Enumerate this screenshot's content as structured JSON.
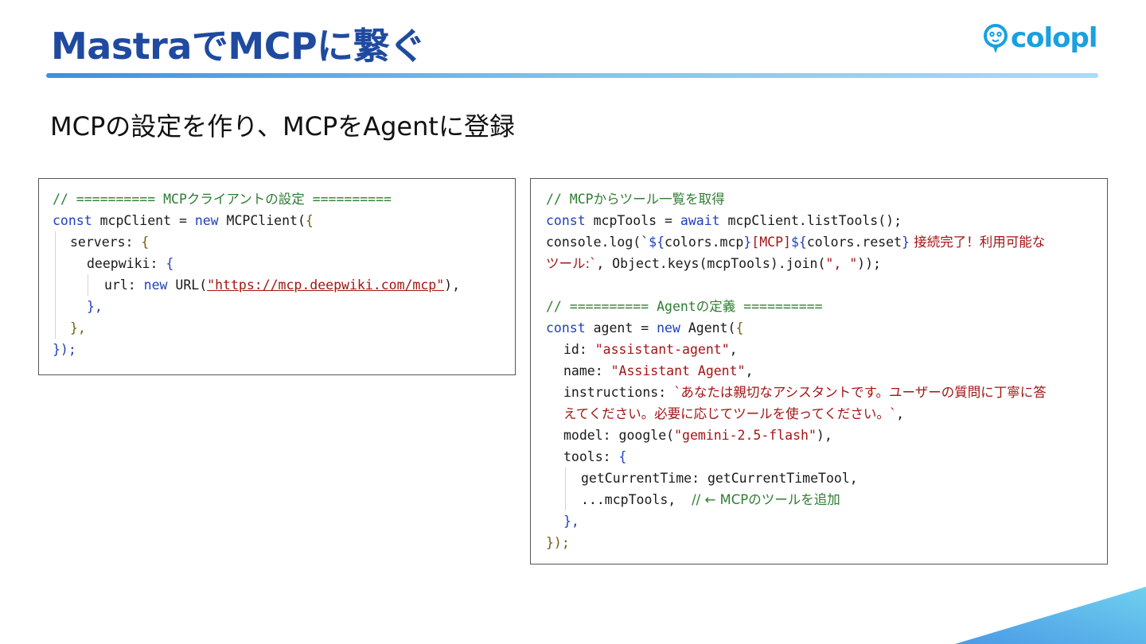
{
  "slide": {
    "title": "MastraでMCPに繋ぐ",
    "logo_text": "colopl",
    "logo_icon": "colopl-mascot-icon",
    "subtitle": "MCPの設定を作り、MCPをAgentに登録",
    "accent_color": "#1f4aa0",
    "logo_color": "#1aa0e0"
  },
  "code_left": {
    "l1": "// ========== MCPクライアントの設定 ==========",
    "l2_kw": "const",
    "l2_a": " mcpClient = ",
    "l2_new": "new",
    "l2_b": " MCPClient(",
    "l2_br": "{",
    "l3": "servers: ",
    "l3_br": "{",
    "l4": "deepwiki: ",
    "l4_br": "{",
    "l5_a": "url: ",
    "l5_new": "new",
    "l5_b": " URL(",
    "l5_url": "\"https://mcp.deepwiki.com/mcp\"",
    "l5_c": "),",
    "l6": "},",
    "l7": "},",
    "l8": "});"
  },
  "code_right": {
    "r1": "// MCPからツール一覧を取得",
    "r2_kw": "const",
    "r2_a": " mcpTools = ",
    "r2_await": "await",
    "r2_b": " mcpClient.listTools();",
    "r3_a": "console.log(`",
    "r3_t1": "${",
    "r3_b": "colors.mcp",
    "r3_t2": "}",
    "r3_c": "[MCP]",
    "r3_t3": "${",
    "r3_d": "colors.reset",
    "r3_t4": "}",
    "r3_e": " 接続完了！利用可能な",
    "r4_a": "ツール:`",
    "r4_b": ", Object.keys(mcpTools).join(",
    "r4_str": "\", \"",
    "r4_c": "));",
    "r6": "// ========== Agentの定義 ==========",
    "r7_kw": "const",
    "r7_a": " agent = ",
    "r7_new": "new",
    "r7_b": " Agent(",
    "r7_br": "{",
    "r8_a": "id: ",
    "r8_str": "\"assistant-agent\"",
    "r8_b": ",",
    "r9_a": "name: ",
    "r9_str": "\"Assistant Agent\"",
    "r9_b": ",",
    "r10_a": "instructions: ",
    "r10_str": "`あなたは親切なアシスタントです。ユーザーの質問に丁寧に答",
    "r11_str": "えてください。必要に応じてツールを使ってください。`",
    "r11_b": ",",
    "r12_a": "model: google(",
    "r12_str": "\"gemini-2.5-flash\"",
    "r12_b": "),",
    "r13_a": "tools: ",
    "r13_br": "{",
    "r14": "getCurrentTime: getCurrentTimeTool,",
    "r15_a": "...mcpTools,  ",
    "r15_c": "// ← MCPのツールを追加",
    "r16": "},",
    "r17": "});"
  }
}
